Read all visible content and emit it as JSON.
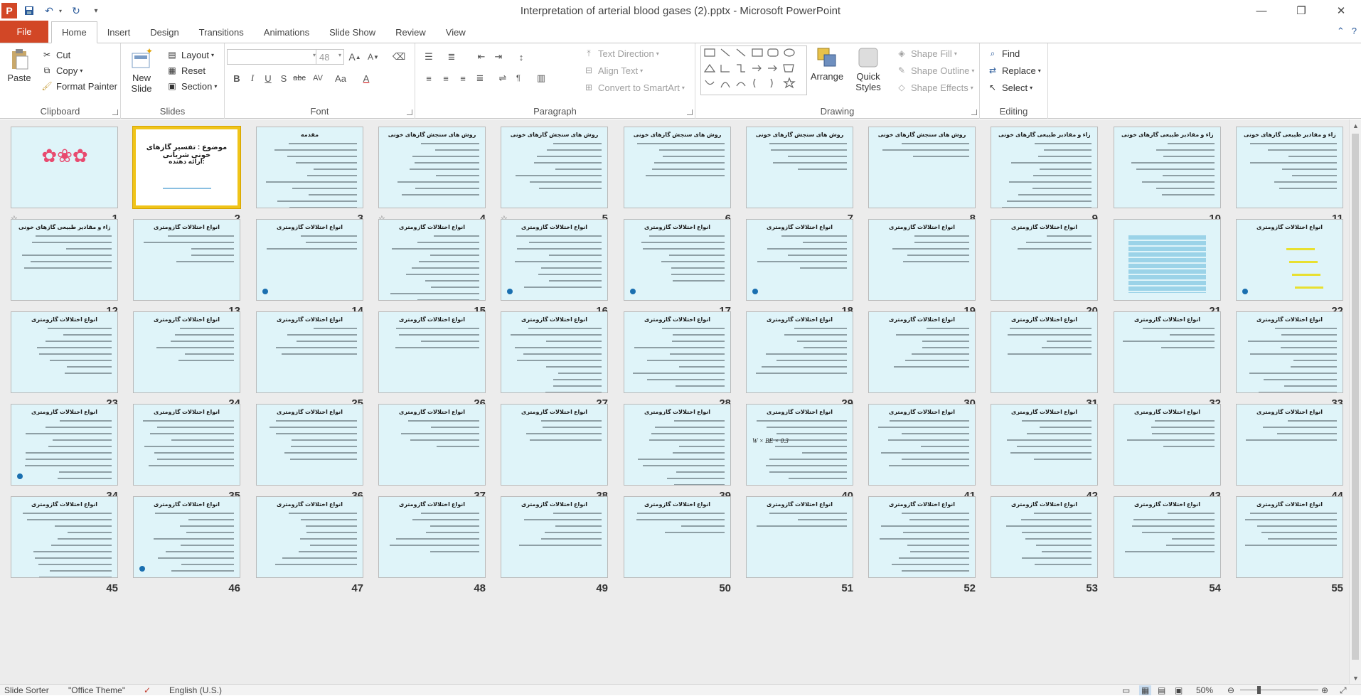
{
  "window": {
    "app_icon": "P",
    "title": "Interpretation of arterial blood gases (2).pptx - Microsoft PowerPoint",
    "minimize": "—",
    "restore": "❐",
    "close": "✕"
  },
  "tabs": [
    {
      "label": "File"
    },
    {
      "label": "Home"
    },
    {
      "label": "Insert"
    },
    {
      "label": "Design"
    },
    {
      "label": "Transitions"
    },
    {
      "label": "Animations"
    },
    {
      "label": "Slide Show"
    },
    {
      "label": "Review"
    },
    {
      "label": "View"
    }
  ],
  "ribbon": {
    "clipboard": {
      "label": "Clipboard",
      "paste": "Paste",
      "cut": "Cut",
      "copy": "Copy",
      "format_painter": "Format Painter"
    },
    "slides": {
      "label": "Slides",
      "new_slide_1": "New",
      "new_slide_2": "Slide",
      "layout": "Layout",
      "reset": "Reset",
      "section": "Section"
    },
    "font": {
      "label": "Font",
      "size": "48"
    },
    "paragraph": {
      "label": "Paragraph",
      "text_direction": "Text Direction",
      "align_text": "Align Text",
      "convert_smartart": "Convert to SmartArt"
    },
    "drawing": {
      "label": "Drawing",
      "arrange": "Arrange",
      "quick_styles_1": "Quick",
      "quick_styles_2": "Styles",
      "shape_fill": "Shape Fill",
      "shape_outline": "Shape Outline",
      "shape_effects": "Shape Effects"
    },
    "editing": {
      "label": "Editing",
      "find": "Find",
      "replace": "Replace",
      "select": "Select"
    }
  },
  "slides": [
    {
      "num": "1",
      "title": ""
    },
    {
      "num": "2",
      "title": "موضوع : تفسیر گازهای خونی شریانی",
      "sub": "ارائه دهنده:"
    },
    {
      "num": "3",
      "title": "مقدمه"
    },
    {
      "num": "4",
      "title": "روش های سنجش گازهای خونی"
    },
    {
      "num": "5",
      "title": "روش های سنجش گازهای خونی"
    },
    {
      "num": "6",
      "title": "روش های سنجش گازهای خونی"
    },
    {
      "num": "7",
      "title": "روش های سنجش گازهای خونی"
    },
    {
      "num": "8",
      "title": "روش های سنجش گازهای خونی"
    },
    {
      "num": "9",
      "title": "اجزاء و مقادیر طبیعی گازهای خونی"
    },
    {
      "num": "10",
      "title": "اجزاء و مقادیر طبیعی گازهای خونی"
    },
    {
      "num": "11",
      "title": "اجزاء و مقادیر طبیعی گازهای خونی"
    },
    {
      "num": "12",
      "title": "اجزاء و مقادیر طبیعی گازهای خونی"
    },
    {
      "num": "13",
      "title": "انواع اختلالات گازومتری"
    },
    {
      "num": "14",
      "title": "انواع اختلالات گازومتری"
    },
    {
      "num": "15",
      "title": "انواع اختلالات گازومتری"
    },
    {
      "num": "16",
      "title": "انواع اختلالات گازومتری"
    },
    {
      "num": "17",
      "title": "انواع اختلالات گازومتری"
    },
    {
      "num": "18",
      "title": "انواع اختلالات گازومتری"
    },
    {
      "num": "19",
      "title": "انواع اختلالات گازومتری"
    },
    {
      "num": "20",
      "title": "انواع اختلالات گازومتری"
    },
    {
      "num": "21",
      "title": ""
    },
    {
      "num": "22",
      "title": "انواع اختلالات گازومتری"
    },
    {
      "num": "23",
      "title": "انواع اختلالات گازومتری"
    },
    {
      "num": "24",
      "title": "انواع اختلالات گازومتری"
    },
    {
      "num": "25",
      "title": "انواع اختلالات گازومتری"
    },
    {
      "num": "26",
      "title": "انواع اختلالات گازومتری"
    },
    {
      "num": "27",
      "title": "انواع اختلالات گازومتری"
    },
    {
      "num": "28",
      "title": "انواع اختلالات گازومتری"
    },
    {
      "num": "29",
      "title": "انواع اختلالات گازومتری"
    },
    {
      "num": "30",
      "title": "انواع اختلالات گازومتری"
    },
    {
      "num": "31",
      "title": "انواع اختلالات گازومتری"
    },
    {
      "num": "32",
      "title": "انواع اختلالات گازومتری"
    },
    {
      "num": "33",
      "title": "انواع اختلالات گازومتری"
    },
    {
      "num": "34",
      "title": "انواع اختلالات گازومتری"
    },
    {
      "num": "35",
      "title": "انواع اختلالات گازومتری"
    },
    {
      "num": "36",
      "title": "انواع اختلالات گازومتری"
    },
    {
      "num": "37",
      "title": "انواع اختلالات گازومتری"
    },
    {
      "num": "38",
      "title": "انواع اختلالات گازومتری"
    },
    {
      "num": "39",
      "title": "انواع اختلالات گازومتری"
    },
    {
      "num": "40",
      "title": "انواع اختلالات گازومتری",
      "formula": "W × BE × 0.3"
    },
    {
      "num": "41",
      "title": "انواع اختلالات گازومتری"
    },
    {
      "num": "42",
      "title": "انواع اختلالات گازومتری"
    },
    {
      "num": "43",
      "title": "انواع اختلالات گازومتری"
    },
    {
      "num": "44",
      "title": "انواع اختلالات گازومتری"
    },
    {
      "num": "45",
      "title": "انواع اختلالات گازومتری"
    },
    {
      "num": "46",
      "title": "انواع اختلالات گازومتری"
    },
    {
      "num": "47",
      "title": "انواع اختلالات گازومتری"
    },
    {
      "num": "48",
      "title": "انواع اختلالات گازومتری"
    },
    {
      "num": "49",
      "title": "انواع اختلالات گازومتری"
    },
    {
      "num": "50",
      "title": "انواع اختلالات گازومتری"
    },
    {
      "num": "51",
      "title": "انواع اختلالات گازومتری"
    },
    {
      "num": "52",
      "title": "انواع اختلالات گازومتری"
    },
    {
      "num": "53",
      "title": "انواع اختلالات گازومتری"
    },
    {
      "num": "54",
      "title": "انواع اختلالات گازومتری"
    },
    {
      "num": "55",
      "title": "انواع اختلالات گازومتری"
    }
  ],
  "statusbar": {
    "view": "Slide Sorter",
    "theme": "\"Office Theme\"",
    "language": "English (U.S.)",
    "zoom": "50%"
  }
}
